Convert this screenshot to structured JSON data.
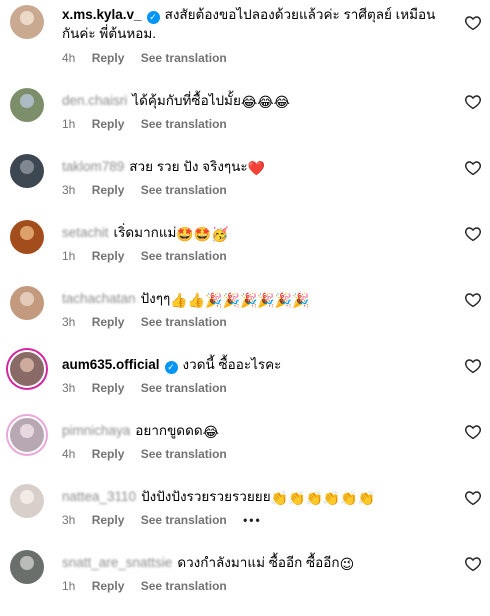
{
  "translate_label": "See translation",
  "reply_label": "Reply",
  "more_glyph": "•••",
  "comments": [
    {
      "username": "x.ms.kyla.v_",
      "verified": true,
      "text": "สงสัยต้องขอไปลองด้วยแล้วค่ะ ราศีตุลย์ เหมือนกันค่ะ พี่ต้นหอม.",
      "emoji": "",
      "time": "4h",
      "avatar_color": "#c9a98f"
    },
    {
      "username": "den.chaisri",
      "verified": false,
      "text": "ได้คุ้มกับที่ซื้อไปมั้ย",
      "emoji": "😂😂😂",
      "time": "1h",
      "avatar_color": "#7c8f6a"
    },
    {
      "username": "taklom789",
      "verified": false,
      "text": "สวย รวย ปัง จริงๆนะ",
      "emoji": "❤️",
      "time": "3h",
      "avatar_color": "#3d4752"
    },
    {
      "username": "setachit",
      "verified": false,
      "text": "เริ่ดมากแม่",
      "emoji": "🤩🤩🥳",
      "time": "1h",
      "avatar_color": "#a34d1c"
    },
    {
      "username": "tachachatan",
      "verified": false,
      "text": "ปังๆๆ",
      "emoji": "👍👍🎉🎉🎉🎉🎉🎉",
      "time": "3h",
      "avatar_color": "#c49a7e"
    },
    {
      "username": "aum635.official",
      "verified": true,
      "text": "งวดนี้ ซื้ออะไรคะ",
      "emoji": "",
      "time": "3h",
      "avatar_color": "#8a6a66"
    },
    {
      "username": "pimnichaya",
      "verified": false,
      "text": "อยากขูดดด",
      "emoji": "😂",
      "time": "4h",
      "avatar_color": "#b8a8b4"
    },
    {
      "username": "nattea_3110",
      "verified": false,
      "text": "ปังปังปังรวยรวยรวยยย",
      "emoji": "👏👏👏👏👏👏",
      "time": "3h",
      "avatar_color": "#d8cfcb"
    },
    {
      "username": "snatt_are_snattsie",
      "verified": false,
      "text": "ดวงกำลังมาแม่ ซื้ออีก ซื้ออีก",
      "emoji": "😉",
      "time": "1h",
      "avatar_color": "#6b6f6c"
    }
  ]
}
